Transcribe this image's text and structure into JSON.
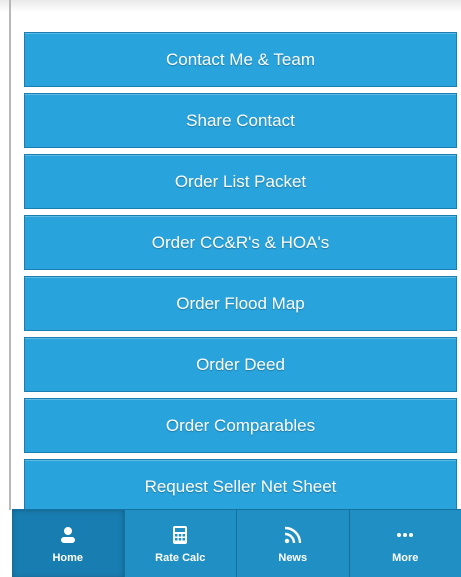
{
  "menu": {
    "buttons": [
      {
        "label": "Contact Me & Team"
      },
      {
        "label": "Share Contact"
      },
      {
        "label": "Order List Packet"
      },
      {
        "label": "Order CC&R's & HOA's"
      },
      {
        "label": "Order Flood Map"
      },
      {
        "label": "Order Deed"
      },
      {
        "label": "Order Comparables"
      },
      {
        "label": "Request Seller Net Sheet"
      }
    ]
  },
  "tabbar": {
    "tabs": [
      {
        "label": "Home",
        "icon": "person-icon",
        "active": true
      },
      {
        "label": "Rate Calc",
        "icon": "calculator-icon",
        "active": false
      },
      {
        "label": "News",
        "icon": "rss-icon",
        "active": false
      },
      {
        "label": "More",
        "icon": "ellipsis-icon",
        "active": false
      }
    ]
  },
  "colors": {
    "button_bg": "#29a3db",
    "tabbar_bg": "#1f8fc4",
    "active_tab_bg": "#187db0",
    "text": "#ffffff"
  }
}
